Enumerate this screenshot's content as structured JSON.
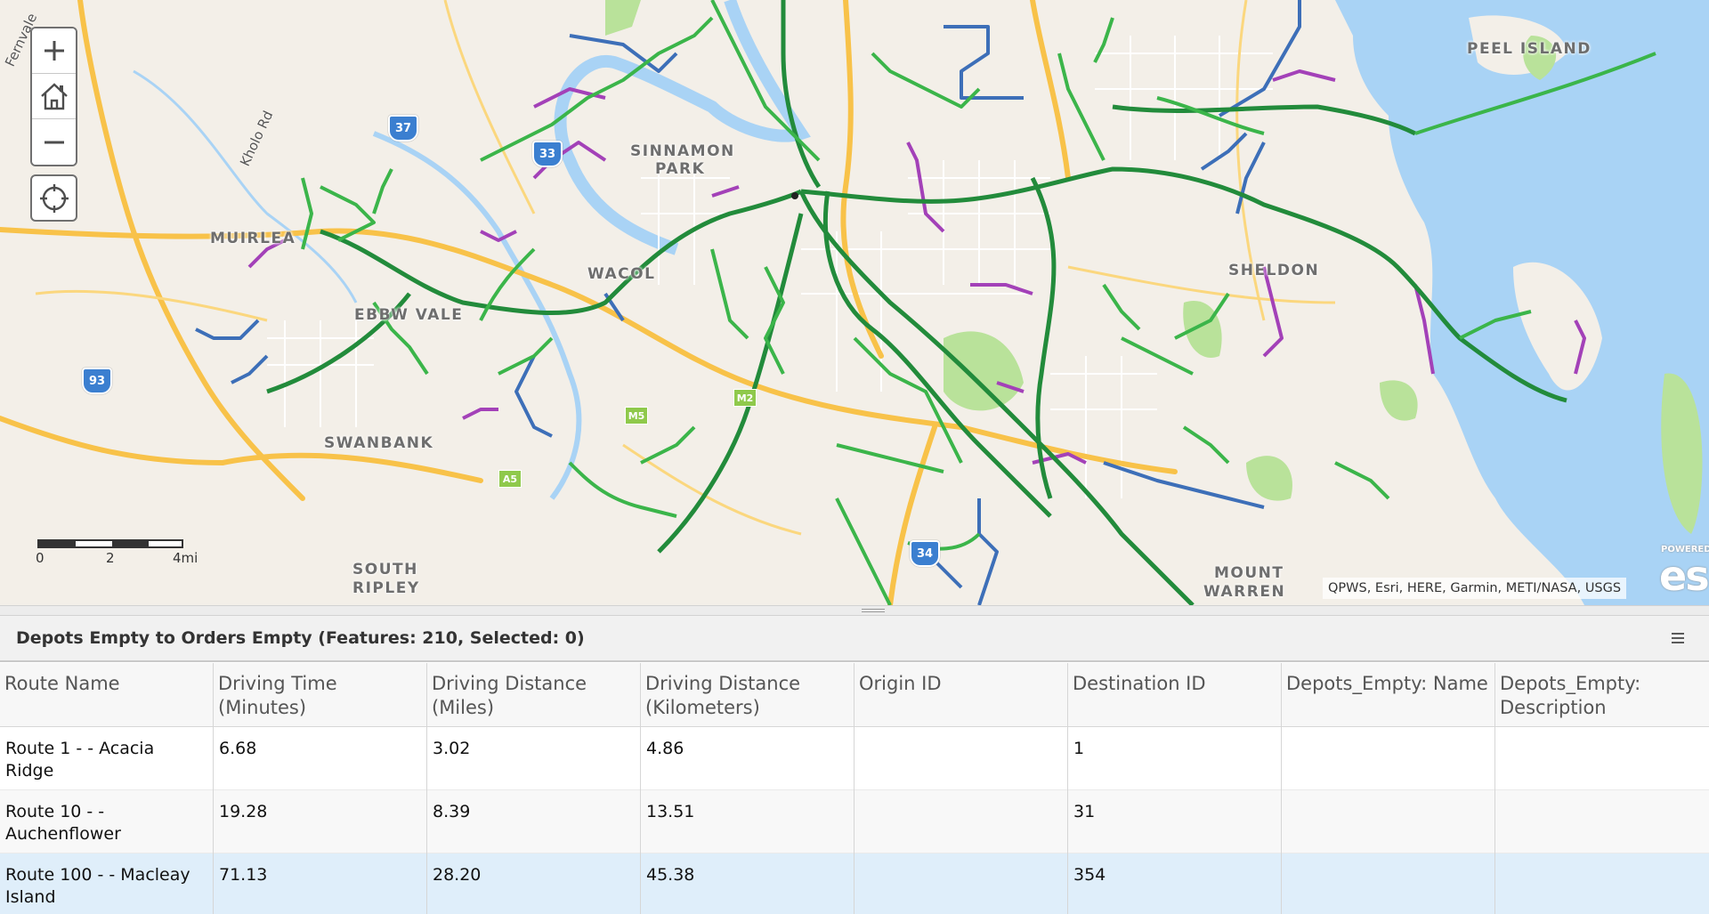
{
  "map": {
    "places": [
      {
        "key": "peel",
        "label": "PEEL ISLAND"
      },
      {
        "key": "sinnamon1",
        "label": "SINNAMON"
      },
      {
        "key": "sinnamon2",
        "label": "PARK"
      },
      {
        "key": "muirlea",
        "label": "MUIRLEA"
      },
      {
        "key": "wacol",
        "label": "WACOL"
      },
      {
        "key": "ebbw",
        "label": "EBBW VALE"
      },
      {
        "key": "sheldon",
        "label": "SHELDON"
      },
      {
        "key": "swanbank",
        "label": "SWANBANK"
      },
      {
        "key": "southripley1",
        "label": "SOUTH"
      },
      {
        "key": "southripley2",
        "label": "RIPLEY"
      },
      {
        "key": "mountwarren1",
        "label": "MOUNT"
      },
      {
        "key": "mountwarren2",
        "label": "WARREN"
      }
    ],
    "road_labels": {
      "kholo": "Kholo Rd",
      "edge": "Fernvale"
    },
    "shields": {
      "s37": "37",
      "s93": "93",
      "s33": "33",
      "s34": "34",
      "s_m2": "M2",
      "s_m5": "M5",
      "s_a5": "A5"
    },
    "controls": {
      "zoom_in_icon": "plus-icon",
      "home_icon": "home-icon",
      "zoom_out_icon": "minus-icon",
      "locate_icon": "crosshair-icon"
    },
    "scalebar": {
      "tick0": "0",
      "tick1": "2",
      "tick2": "4mi"
    },
    "attribution": "QPWS, Esri, HERE, Garmin, METI/NASA, USGS",
    "logo": {
      "powered": "POWERED",
      "name": "esri"
    },
    "colors": {
      "background": "#f3efe8",
      "water": "#a9d3f5",
      "park": "#b9e29a",
      "highway": "#f8c249",
      "route_green": "#3bb54a",
      "route_dark_green": "#228b3b",
      "route_blue": "#3d6fb8",
      "route_purple": "#a341b8"
    }
  },
  "table": {
    "title": "Depots Empty to Orders Empty (Features: 210, Selected: 0)",
    "menu_icon": "hamburger-icon",
    "columns": [
      "Route Name",
      "Driving Time (Minutes)",
      "Driving Distance (Miles)",
      "Driving Distance (Kilometers)",
      "Origin ID",
      "Destination ID",
      "Depots_Empty: Name",
      "Depots_Empty: Description"
    ],
    "rows": [
      {
        "route_name": "Route 1 - - Acacia Ridge",
        "time": "6.68",
        "miles": "3.02",
        "km": "4.86",
        "origin": "",
        "dest": "1",
        "depot_name": "",
        "depot_desc": ""
      },
      {
        "route_name": "Route 10 - - Auchenflower",
        "time": "19.28",
        "miles": "8.39",
        "km": "13.51",
        "origin": "",
        "dest": "31",
        "depot_name": "",
        "depot_desc": ""
      },
      {
        "route_name": "Route 100 - - Macleay Island",
        "time": "71.13",
        "miles": "28.20",
        "km": "45.38",
        "origin": "",
        "dest": "354",
        "depot_name": "",
        "depot_desc": ""
      }
    ]
  }
}
